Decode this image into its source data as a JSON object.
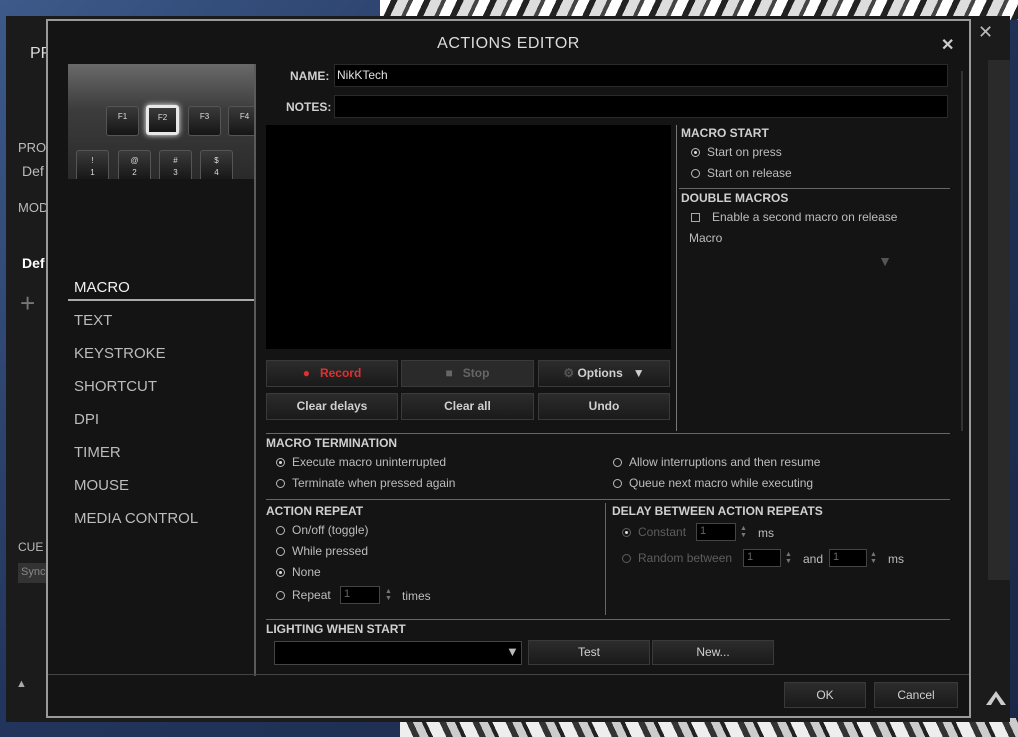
{
  "background": {
    "profile_label_partial": "PR",
    "profiles_label_partial": "PRO",
    "profile_value_partial": "Def",
    "mode_label_partial": "MOD",
    "mode_value_partial": "Def",
    "cue_label_partial": "CUE",
    "sync_partial": "Sync",
    "close_glyph": "✕",
    "up_glyph": "▲",
    "logo_glyph": "⚓"
  },
  "dialog": {
    "title": "ACTIONS EDITOR",
    "close_glyph": "✕"
  },
  "keyboard_preview": {
    "row1": [
      "F1",
      "F2",
      "F3",
      "F4"
    ],
    "row2": [
      [
        "!",
        "1"
      ],
      [
        "@",
        "2"
      ],
      [
        "#",
        "3"
      ],
      [
        "$",
        "4"
      ]
    ],
    "selected_key": "F2"
  },
  "nav": {
    "items": [
      "MACRO",
      "TEXT",
      "KEYSTROKE",
      "SHORTCUT",
      "DPI",
      "TIMER",
      "MOUSE",
      "MEDIA CONTROL"
    ],
    "active": "MACRO"
  },
  "form": {
    "name_label": "NAME:",
    "name_value": "NikKTech",
    "notes_label": "NOTES:",
    "notes_value": ""
  },
  "macro_buttons": {
    "record": "Record",
    "stop": "Stop",
    "options": "Options",
    "clear_delays": "Clear delays",
    "clear_all": "Clear all",
    "undo": "Undo"
  },
  "macro_start": {
    "header": "MACRO START",
    "start_on_press": "Start on press",
    "start_on_release": "Start on release",
    "selected": "Start on press"
  },
  "double_macros": {
    "header": "DOUBLE MACROS",
    "enable_second": "Enable a second macro on release",
    "macro_label": "Macro"
  },
  "macro_termination": {
    "header": "MACRO TERMINATION",
    "execute_uninterrupted": "Execute macro uninterrupted",
    "terminate_pressed_again": "Terminate when pressed again",
    "allow_interruptions": "Allow interruptions and then resume",
    "queue_next": "Queue next macro while executing",
    "selected": "Execute macro uninterrupted"
  },
  "action_repeat": {
    "header": "ACTION REPEAT",
    "on_off": "On/off (toggle)",
    "while_pressed": "While pressed",
    "none": "None",
    "repeat": "Repeat",
    "repeat_value": "1",
    "times": "times",
    "selected": "None"
  },
  "delay_repeats": {
    "header": "DELAY BETWEEN ACTION REPEATS",
    "constant": "Constant",
    "constant_value": "1",
    "ms": "ms",
    "random_between": "Random between",
    "random_min": "1",
    "and": "and",
    "random_max": "1",
    "ms2": "ms"
  },
  "lighting": {
    "header": "LIGHTING WHEN START",
    "test": "Test",
    "new": "New..."
  },
  "footer": {
    "ok": "OK",
    "cancel": "Cancel"
  },
  "colors": {
    "record_accent": "#e03030",
    "dialog_bg": "#141414",
    "dialog_border": "#9a9a9a"
  }
}
